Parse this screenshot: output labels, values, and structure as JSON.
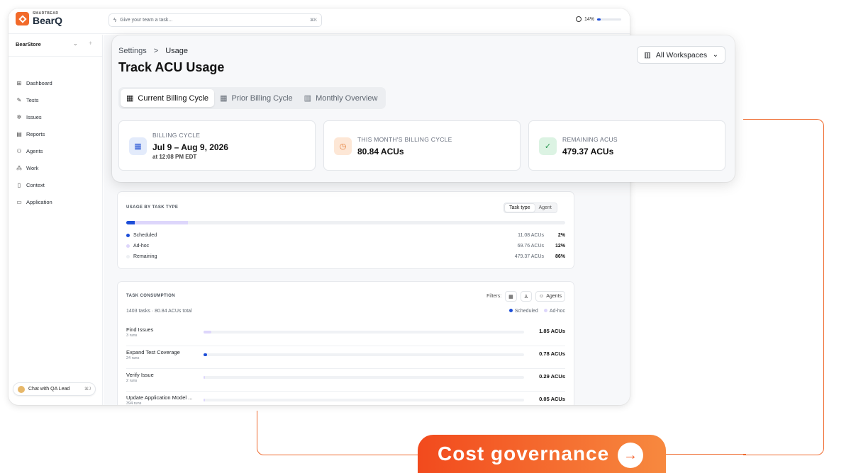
{
  "app": {
    "brand_small": "SMARTBEAR",
    "brand_name": "BearQ",
    "search_placeholder": "Give your team a task...",
    "search_shortcut": "⌘K",
    "usage_percent": "14%",
    "usage_fraction": 0.14
  },
  "sidebar": {
    "workspace": "BearStore",
    "items": [
      {
        "label": "Dashboard",
        "icon": "grid-icon"
      },
      {
        "label": "Tests",
        "icon": "pencil-icon"
      },
      {
        "label": "Issues",
        "icon": "bug-icon"
      },
      {
        "label": "Reports",
        "icon": "report-icon"
      },
      {
        "label": "Agents",
        "icon": "agents-icon"
      },
      {
        "label": "Work",
        "icon": "work-icon"
      },
      {
        "label": "Context",
        "icon": "document-icon"
      },
      {
        "label": "Application",
        "icon": "window-icon"
      }
    ],
    "chat_label": "Chat with QA Lead",
    "chat_shortcut": "⌘J"
  },
  "header": {
    "breadcrumb_root": "Settings",
    "breadcrumb_sep": ">",
    "breadcrumb_current": "Usage",
    "title": "Track ACU Usage",
    "workspace_select": "All Workspaces"
  },
  "tabs": [
    {
      "label": "Current Billing Cycle",
      "active": true
    },
    {
      "label": "Prior Billing Cycle",
      "active": false
    },
    {
      "label": "Monthly Overview",
      "active": false
    }
  ],
  "stats": {
    "billing": {
      "label": "BILLING CYCLE",
      "value": "Jul 9 – Aug 9, 2026",
      "sub": "at 12:08 PM EDT"
    },
    "month": {
      "label": "THIS MONTH'S BILLING CYCLE",
      "value": "80.84 ACUs"
    },
    "remaining": {
      "label": "REMAINING ACUS",
      "value": "479.37 ACUs"
    }
  },
  "usage_by_type": {
    "title": "USAGE BY TASK TYPE",
    "toggle": [
      "Task type",
      "Agent"
    ],
    "rows": [
      {
        "label": "Scheduled",
        "value": "11.08 ACUs",
        "percent": "2%",
        "color": "#1d4ed8"
      },
      {
        "label": "Ad-hoc",
        "value": "69.76 ACUs",
        "percent": "12%",
        "color": "#ddd6fb"
      },
      {
        "label": "Remaining",
        "value": "479.37 ACUs",
        "percent": "86%",
        "color": "#eef0f3"
      }
    ],
    "bar_scheduled_fraction": 0.02,
    "bar_adhoc_fraction": 0.12
  },
  "task_consumption": {
    "title": "TASK CONSUMPTION",
    "filters_label": "Filters:",
    "agents_button": "Agents",
    "summary": "1403 tasks · 80.84 ACUs total",
    "legend": [
      "Scheduled",
      "Ad-hoc"
    ],
    "rows": [
      {
        "name": "Find Issues",
        "runs": "3 runs",
        "value": "1.85 ACUs",
        "sched": 0.0,
        "adhoc": 0.024
      },
      {
        "name": "Expand Test Coverage",
        "runs": "24 runs",
        "value": "0.78 ACUs",
        "sched": 0.01,
        "adhoc": 0.0
      },
      {
        "name": "Verify Issue",
        "runs": "2 runs",
        "value": "0.29 ACUs",
        "sched": 0.0,
        "adhoc": 0.003
      },
      {
        "name": "Update Application Model ...",
        "runs": "394 runs",
        "value": "0.05 ACUs",
        "sched": 0.0,
        "adhoc": 0.002
      }
    ]
  },
  "cta": {
    "label": "Cost governance"
  },
  "colors": {
    "accent": "#f26a2a",
    "scheduled": "#1d4ed8",
    "adhoc": "#ddd6fb"
  }
}
